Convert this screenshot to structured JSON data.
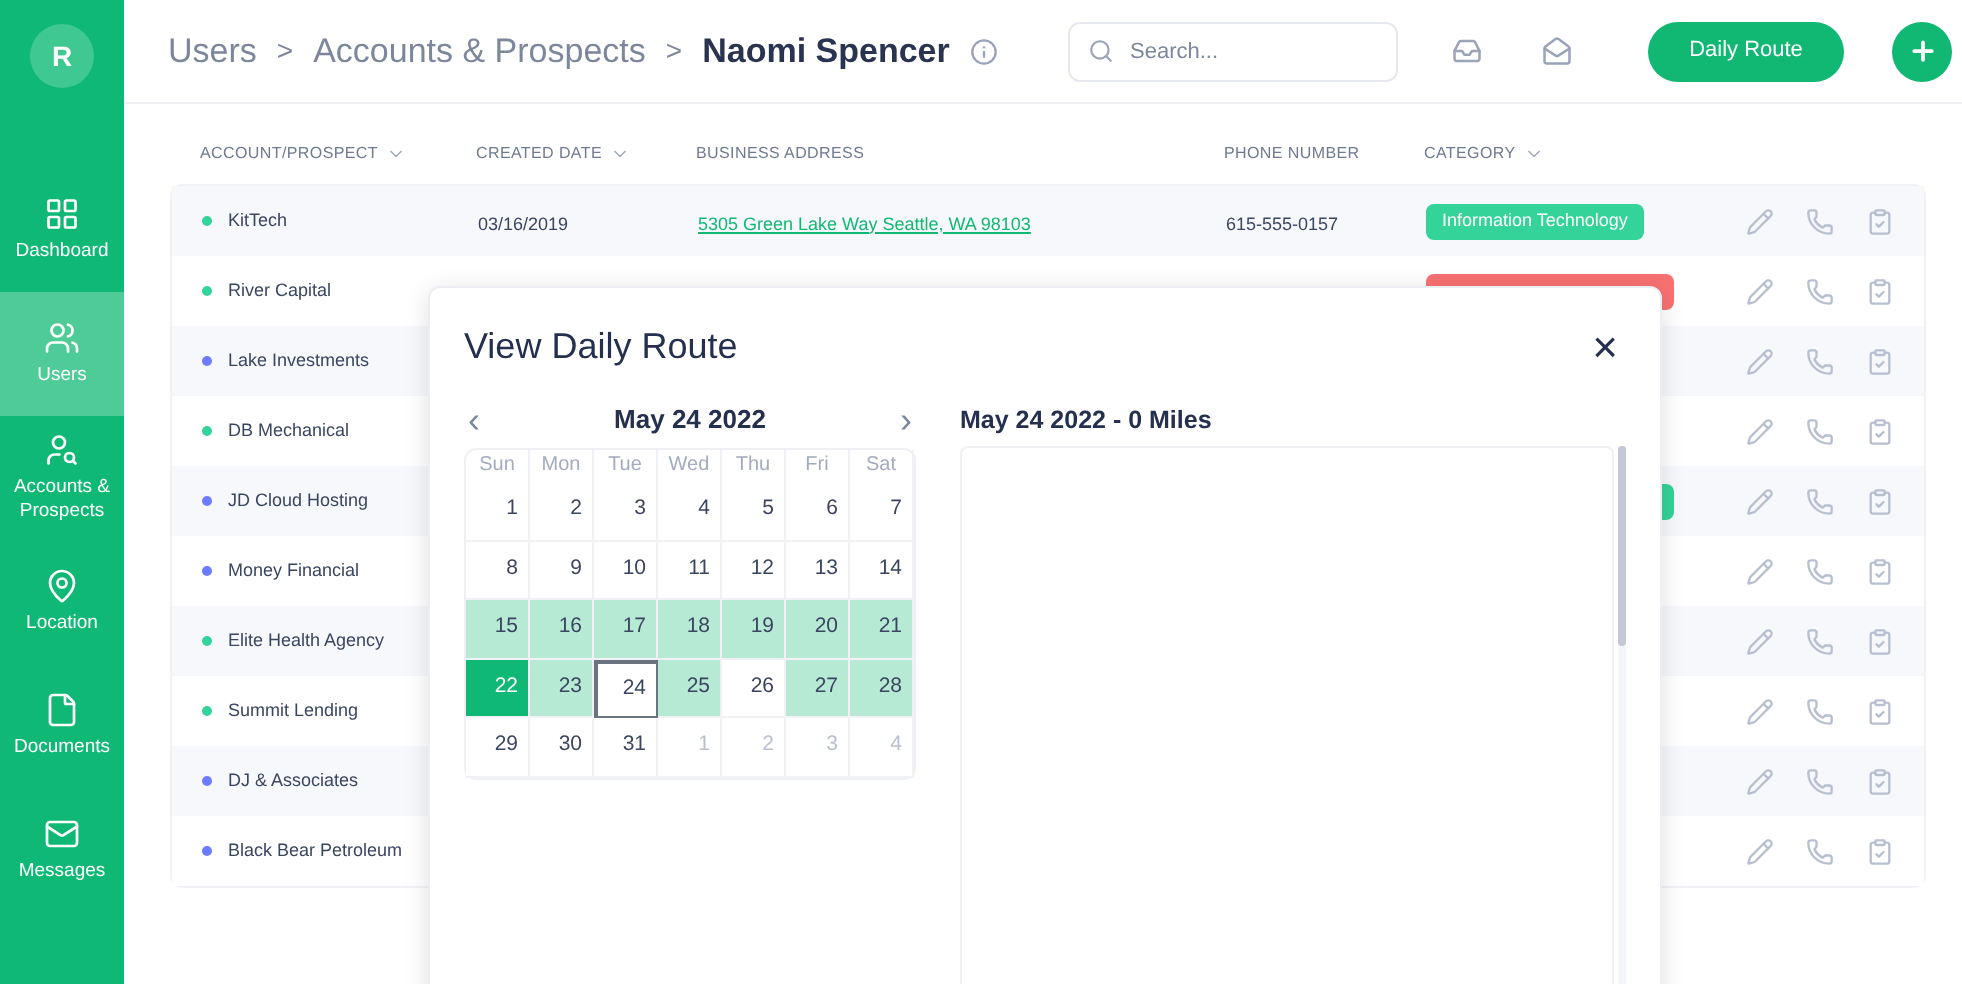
{
  "sidebar": {
    "logo": "R",
    "items": [
      {
        "label": "Dashboard",
        "selected": false
      },
      {
        "label": "Users",
        "selected": true
      },
      {
        "label": "Accounts & Prospects",
        "selected": false
      },
      {
        "label": "Location",
        "selected": false
      },
      {
        "label": "Documents",
        "selected": false
      },
      {
        "label": "Messages",
        "selected": false
      }
    ]
  },
  "header": {
    "breadcrumbs": [
      {
        "label": "Users",
        "current": false
      },
      {
        "label": "Accounts & Prospects",
        "current": false
      },
      {
        "label": "Naomi Spencer",
        "current": true
      }
    ],
    "separator": ">",
    "search": {
      "placeholder": "Search..."
    },
    "route_button": "Daily Route"
  },
  "table": {
    "columns": [
      {
        "label": "ACCOUNT/PROSPECT",
        "sortable": true
      },
      {
        "label": "CREATED DATE",
        "sortable": true
      },
      {
        "label": "BUSINESS ADDRESS",
        "sortable": false
      },
      {
        "label": "PHONE NUMBER",
        "sortable": false
      },
      {
        "label": "CATEGORY",
        "sortable": true
      }
    ],
    "rows": [
      {
        "name": "KitTech",
        "color": "#34d399",
        "date": "03/16/2019",
        "address": "5305 Green Lake Way Seattle, WA 98103",
        "phone": "615-555-0157",
        "category": {
          "label": "Information Technology",
          "color": "#34d399"
        }
      },
      {
        "name": "River Capital",
        "color": "#34d399",
        "category": {
          "color": "#f87171"
        }
      },
      {
        "name": "Lake Investments",
        "color": "#6d7cff"
      },
      {
        "name": "DB Mechanical",
        "color": "#34d399"
      },
      {
        "name": "JD Cloud Hosting",
        "color": "#6d7cff",
        "category": {
          "color": "#34d399"
        }
      },
      {
        "name": "Money Financial",
        "color": "#6d7cff"
      },
      {
        "name": "Elite Health Agency",
        "color": "#34d399"
      },
      {
        "name": "Summit Lending",
        "color": "#34d399"
      },
      {
        "name": "DJ & Associates",
        "color": "#6d7cff"
      },
      {
        "name": "Black Bear Petroleum",
        "color": "#6d7cff"
      }
    ]
  },
  "modal": {
    "title": "View Daily Route",
    "close": "×",
    "calendar": {
      "prev": "‹",
      "next": "›",
      "month": "May 24 2022",
      "weekdays": [
        "Sun",
        "Mon",
        "Tue",
        "Wed",
        "Thu",
        "Fri",
        "Sat"
      ],
      "days": [
        {
          "label": "1",
          "kind": "current",
          "in_range": false,
          "selected": false,
          "today": false
        },
        {
          "label": "2",
          "kind": "current",
          "in_range": false,
          "selected": false,
          "today": false
        },
        {
          "label": "3",
          "kind": "current",
          "in_range": false,
          "selected": false,
          "today": false
        },
        {
          "label": "4",
          "kind": "current",
          "in_range": false,
          "selected": false,
          "today": false
        },
        {
          "label": "5",
          "kind": "current",
          "in_range": false,
          "selected": false,
          "today": false
        },
        {
          "label": "6",
          "kind": "current",
          "in_range": false,
          "selected": false,
          "today": false
        },
        {
          "label": "7",
          "kind": "current",
          "in_range": false,
          "selected": false,
          "today": false
        },
        {
          "label": "8",
          "kind": "current",
          "in_range": false,
          "selected": false,
          "today": false
        },
        {
          "label": "9",
          "kind": "current",
          "in_range": false,
          "selected": false,
          "today": false
        },
        {
          "label": "10",
          "kind": "current",
          "in_range": false,
          "selected": false,
          "today": false
        },
        {
          "label": "11",
          "kind": "current",
          "in_range": false,
          "selected": false,
          "today": false
        },
        {
          "label": "12",
          "kind": "current",
          "in_range": false,
          "selected": false,
          "today": false
        },
        {
          "label": "13",
          "kind": "current",
          "in_range": false,
          "selected": false,
          "today": false
        },
        {
          "label": "14",
          "kind": "current",
          "in_range": false,
          "selected": false,
          "today": false
        },
        {
          "label": "15",
          "kind": "current",
          "in_range": true,
          "selected": false,
          "today": false
        },
        {
          "label": "16",
          "kind": "current",
          "in_range": true,
          "selected": false,
          "today": false
        },
        {
          "label": "17",
          "kind": "current",
          "in_range": true,
          "selected": false,
          "today": false
        },
        {
          "label": "18",
          "kind": "current",
          "in_range": true,
          "selected": false,
          "today": false
        },
        {
          "label": "19",
          "kind": "current",
          "in_range": true,
          "selected": false,
          "today": false
        },
        {
          "label": "20",
          "kind": "current",
          "in_range": true,
          "selected": false,
          "today": false
        },
        {
          "label": "21",
          "kind": "current",
          "in_range": true,
          "selected": false,
          "today": false
        },
        {
          "label": "22",
          "kind": "current",
          "in_range": true,
          "selected": true,
          "today": false
        },
        {
          "label": "23",
          "kind": "current",
          "in_range": true,
          "selected": false,
          "today": false
        },
        {
          "label": "24",
          "kind": "current",
          "in_range": false,
          "selected": false,
          "today": true
        },
        {
          "label": "25",
          "kind": "current",
          "in_range": true,
          "selected": false,
          "today": false
        },
        {
          "label": "26",
          "kind": "current",
          "in_range": false,
          "selected": false,
          "today": false
        },
        {
          "label": "27",
          "kind": "current",
          "in_range": true,
          "selected": false,
          "today": false
        },
        {
          "label": "28",
          "kind": "current",
          "in_range": true,
          "selected": false,
          "today": false
        },
        {
          "label": "29",
          "kind": "current",
          "in_range": false,
          "selected": false,
          "today": false
        },
        {
          "label": "30",
          "kind": "current",
          "in_range": false,
          "selected": false,
          "today": false
        },
        {
          "label": "31",
          "kind": "current",
          "in_range": false,
          "selected": false,
          "today": false
        },
        {
          "label": "1",
          "kind": "other",
          "in_range": false,
          "selected": false,
          "today": false
        },
        {
          "label": "2",
          "kind": "other",
          "in_range": false,
          "selected": false,
          "today": false
        },
        {
          "label": "3",
          "kind": "other",
          "in_range": false,
          "selected": false,
          "today": false
        },
        {
          "label": "4",
          "kind": "other",
          "in_range": false,
          "selected": false,
          "today": false
        }
      ]
    },
    "route_title": "May 24 2022 - 0 Miles"
  }
}
